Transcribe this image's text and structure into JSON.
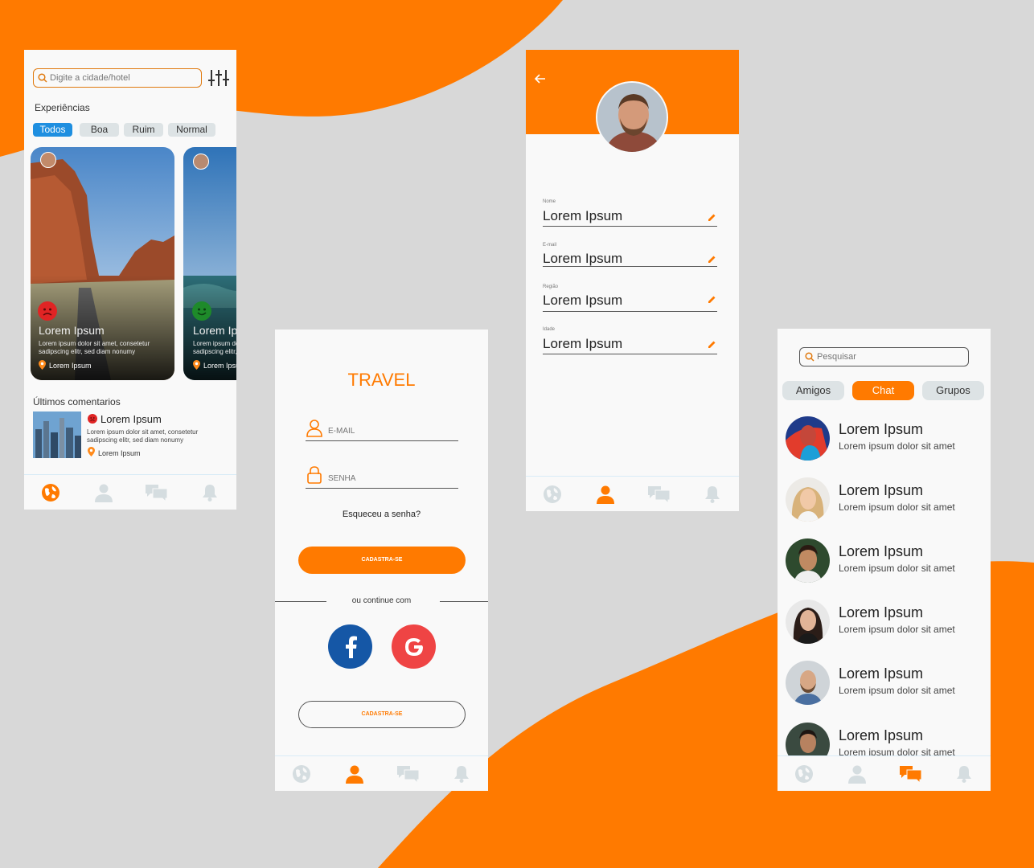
{
  "colors": {
    "orange": "#ff7a00",
    "blue": "#1f8fe0",
    "navInactive": "#d5dde0",
    "facebook": "#1557a6",
    "google": "#ef4444"
  },
  "explore": {
    "search_placeholder": "Digite a cidade/hotel",
    "section_title": "Experiências",
    "filters": [
      "Todos",
      "Boa",
      "Ruim",
      "Normal"
    ],
    "cards": [
      {
        "title": "Lorem Ipsum",
        "desc1": "Lorem ipsum dolor sit amet, consetetur",
        "desc2": "sadipscing elitr, sed diam nonumy",
        "location": "Lorem Ipsum",
        "mood": "sad"
      },
      {
        "title": "Lorem Ipsum",
        "desc1": "Lorem ipsum dolor sit amet, consetetur",
        "desc2": "sadipscing elitr, sed diam nonumy",
        "location": "Lorem Ipsum",
        "mood": "happy"
      }
    ],
    "comments_title": "Últimos comentarios",
    "comment": {
      "title": "Lorem Ipsum",
      "desc1": "Lorem ipsum dolor sit amet, consetetur",
      "desc2": "sadipscing elitr, sed diam nonumy",
      "location": "Lorem Ipsum"
    }
  },
  "login": {
    "brand": "TRAVEL",
    "email_placeholder": "E-MAIL",
    "password_placeholder": "SENHA",
    "forgot": "Esqueceu a senha?",
    "primary_button": "CADASTRA-SE",
    "divider": "ou continue com",
    "secondary_button": "CADASTRA-SE"
  },
  "profile": {
    "fields": [
      {
        "label": "Nome",
        "value": "Lorem Ipsum"
      },
      {
        "label": "E-mail",
        "value": "Lorem Ipsum"
      },
      {
        "label": "Região",
        "value": "Lorem Ipsum"
      },
      {
        "label": "Idade",
        "value": "Lorem Ipsum"
      }
    ]
  },
  "chat": {
    "search_placeholder": "Pesquisar",
    "tabs": [
      "Amigos",
      "Chat",
      "Grupos"
    ],
    "items": [
      {
        "name": "Lorem Ipsum",
        "message": "Lorem ipsum dolor sit amet"
      },
      {
        "name": "Lorem Ipsum",
        "message": "Lorem ipsum dolor sit amet"
      },
      {
        "name": "Lorem Ipsum",
        "message": "Lorem ipsum dolor sit amet"
      },
      {
        "name": "Lorem Ipsum",
        "message": "Lorem ipsum dolor sit amet"
      },
      {
        "name": "Lorem Ipsum",
        "message": "Lorem ipsum dolor sit amet"
      },
      {
        "name": "Lorem Ipsum",
        "message": "Lorem ipsum dolor sit amet"
      }
    ]
  },
  "nav_icons": [
    "globe-icon",
    "user-icon",
    "chat-icon",
    "bell-icon"
  ]
}
